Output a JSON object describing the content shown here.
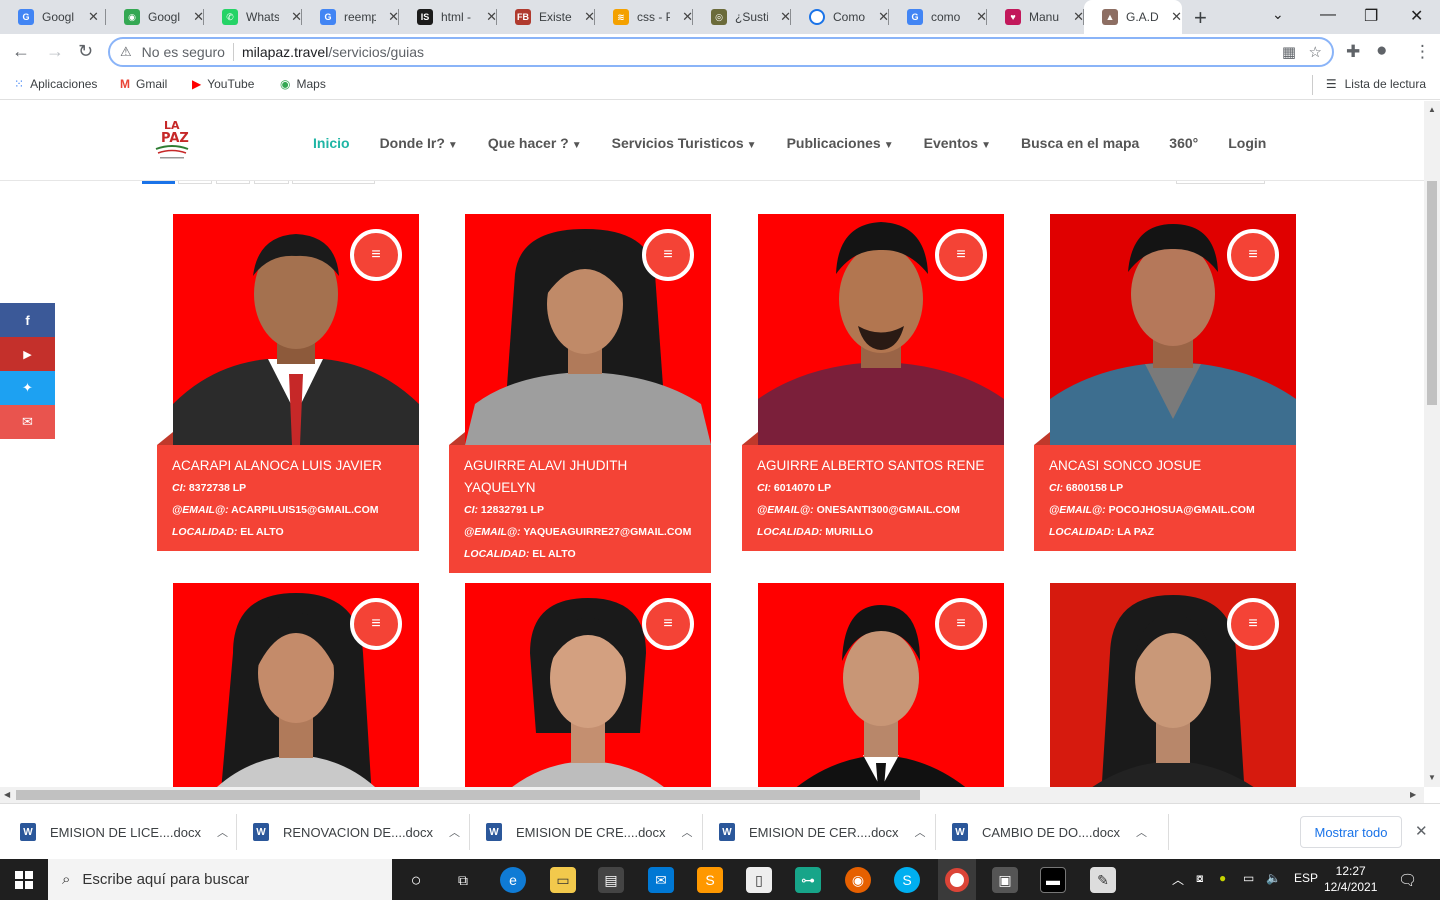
{
  "browser": {
    "tabs": [
      {
        "label": "Googl",
        "icon": "google-icon",
        "color": "#4285f4"
      },
      {
        "label": "Googl",
        "icon": "maps-icon",
        "color": "#34a853"
      },
      {
        "label": "Whats",
        "icon": "whatsapp-icon",
        "color": "#25d366"
      },
      {
        "label": "reemp",
        "icon": "google-icon",
        "color": "#4285f4"
      },
      {
        "label": "html -",
        "icon": "is-icon",
        "color": "#1b1b1b"
      },
      {
        "label": "Existe",
        "icon": "fb-icon",
        "color": "#b03a2e"
      },
      {
        "label": "css - P",
        "icon": "stack-icon",
        "color": "#f4a100"
      },
      {
        "label": "¿Sustit",
        "icon": "sustit-icon",
        "color": "#6b6b3a"
      },
      {
        "label": "Como",
        "icon": "loading-icon",
        "color": "#1a73e8"
      },
      {
        "label": "como",
        "icon": "google-icon",
        "color": "#4285f4"
      },
      {
        "label": "Manu",
        "icon": "manu-icon",
        "color": "#c2185b"
      },
      {
        "label": "G.A.D",
        "icon": "gad-icon",
        "color": "#8d6e63"
      }
    ],
    "new_tab": "+",
    "security_label": "No es seguro",
    "url_host": "milapaz.travel",
    "url_path": "/servicios/guias",
    "bookmarks": [
      {
        "label": "Aplicaciones",
        "icon": "apps-grid-icon"
      },
      {
        "label": "Gmail",
        "icon": "gmail-icon"
      },
      {
        "label": "YouTube",
        "icon": "youtube-icon"
      },
      {
        "label": "Maps",
        "icon": "maps-icon"
      }
    ],
    "reading_list": "Lista de lectura"
  },
  "site": {
    "logo_text": "LA PAZ",
    "menu": [
      {
        "label": "Inicio",
        "caret": false,
        "active": true
      },
      {
        "label": "Donde Ir?",
        "caret": true,
        "active": false
      },
      {
        "label": "Que hacer ?",
        "caret": true,
        "active": false
      },
      {
        "label": "Servicios Turisticos",
        "caret": true,
        "active": false
      },
      {
        "label": "Publicaciones",
        "caret": true,
        "active": false
      },
      {
        "label": "Eventos",
        "caret": true,
        "active": false
      },
      {
        "label": "Busca en el mapa",
        "caret": false,
        "active": false
      },
      {
        "label": "360°",
        "caret": false,
        "active": false
      },
      {
        "label": "Login",
        "caret": false,
        "active": false
      }
    ],
    "social": [
      {
        "icon": "facebook-icon",
        "glyph": "f",
        "color": "#3b5998"
      },
      {
        "icon": "youtube-icon",
        "glyph": "▶",
        "color": "#c4302b"
      },
      {
        "icon": "twitter-icon",
        "glyph": "🐦",
        "color": "#1da1f2"
      },
      {
        "icon": "email-icon",
        "glyph": "✉",
        "color": "#e9544e"
      }
    ],
    "guides": [
      {
        "name": "ACARAPI ALANOCA LUIS JAVIER",
        "ci": "8372738 LP",
        "email": "ACARPILUIS15@GMAIL.COM",
        "locality": "EL ALTO"
      },
      {
        "name": "AGUIRRE ALAVI JHUDITH YAQUELYN",
        "ci": "12832791 LP",
        "email": "YAQUEAGUIRRE27@GMAIL.COM",
        "locality": "EL ALTO"
      },
      {
        "name": "AGUIRRE ALBERTO SANTOS RENE",
        "ci": "6014070 LP",
        "email": "ONESANTI300@GMAIL.COM",
        "locality": "MURILLO"
      },
      {
        "name": "ANCASI SONCO JOSUE",
        "ci": "6800158 LP",
        "email": "POCOJHOSUA@GMAIL.COM",
        "locality": "LA PAZ"
      }
    ],
    "labels": {
      "ci": "CI:",
      "email": "@EMAIL@:",
      "locality": "LOCALIDAD:"
    }
  },
  "downloads": {
    "items": [
      "EMISION DE LICE....docx",
      "RENOVACION DE....docx",
      "EMISION DE CRE....docx",
      "EMISION DE CER....docx",
      "CAMBIO DE DO....docx"
    ],
    "show_all": "Mostrar todo"
  },
  "taskbar": {
    "search_placeholder": "Escribe aquí para buscar",
    "lang": "ESP",
    "time": "12:27",
    "date": "12/4/2021"
  }
}
